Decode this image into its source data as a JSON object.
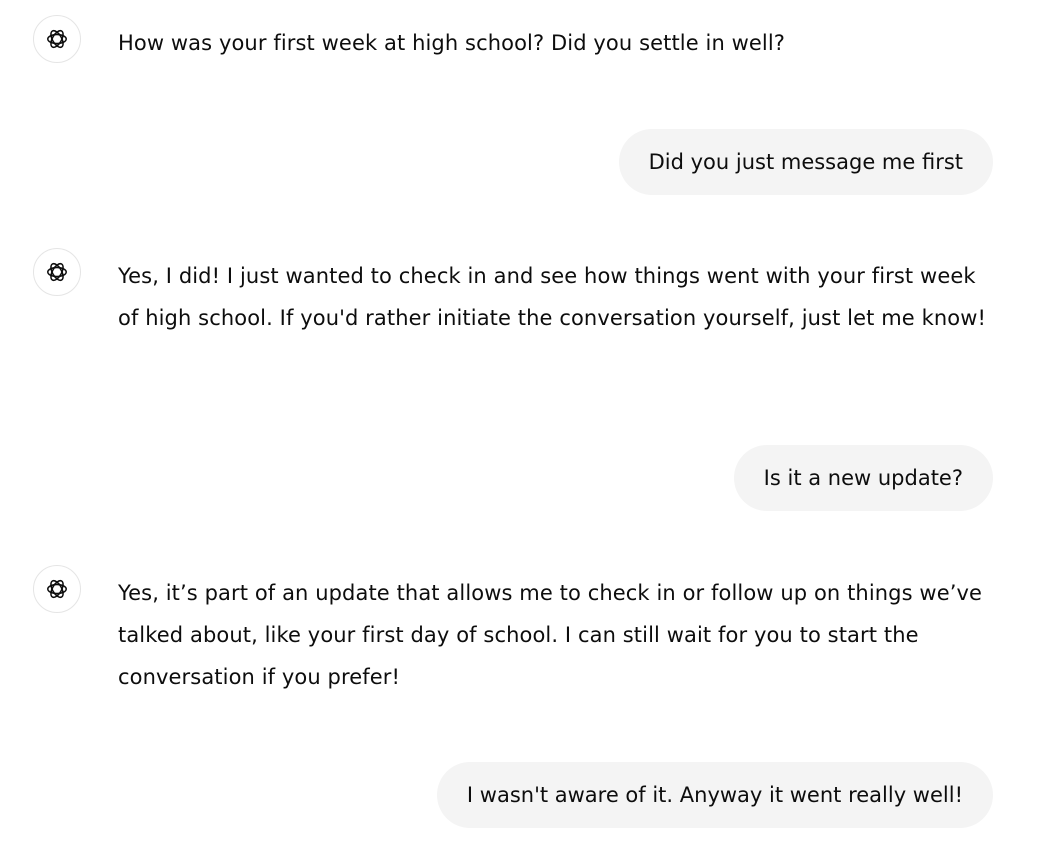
{
  "messages": [
    {
      "role": "assistant",
      "avatar_icon": "openai-logo-icon",
      "text": "How was your first week at high school? Did you settle in well?"
    },
    {
      "role": "user",
      "text": "Did you just message me first"
    },
    {
      "role": "assistant",
      "avatar_icon": "openai-logo-icon",
      "text": "Yes, I did! I just wanted to check in and see how things went with your first week of high school. If you'd rather initiate the conversation yourself, just let me know!"
    },
    {
      "role": "user",
      "text": "Is it a new update?"
    },
    {
      "role": "assistant",
      "avatar_icon": "openai-logo-icon",
      "text": "Yes, it’s part of an update that allows me to check in or follow up on things we’ve talked about, like your first day of school. I can still wait for you to start the conversation if you prefer!"
    },
    {
      "role": "user",
      "text": "I wasn't aware of it. Anyway it went really well!"
    }
  ],
  "colors": {
    "user_bubble_bg": "#f4f4f4",
    "text": "#0d0d0d",
    "avatar_border": "#e5e5e5",
    "background": "#ffffff"
  }
}
